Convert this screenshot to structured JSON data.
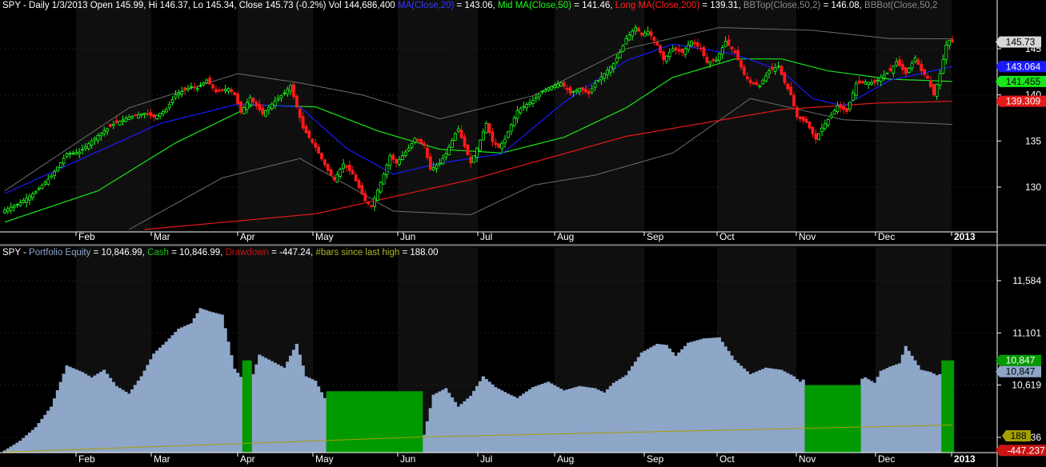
{
  "top_legend": [
    {
      "text": "SPY - Daily 1/3/2013 Open 145.99, Hi 146.37, Lo 145.34, Close 145.73 (-0.2%) Vol 144,686,400 ",
      "color": "#ffffff"
    },
    {
      "text": "MA(Close,20)",
      "color": "#3a3aff"
    },
    {
      "text": " = 143.06, ",
      "color": "#ffffff"
    },
    {
      "text": "Mid MA(Close,50)",
      "color": "#19ff19"
    },
    {
      "text": " = 141.46, ",
      "color": "#ffffff"
    },
    {
      "text": "Long MA(Close,200)",
      "color": "#ff2020"
    },
    {
      "text": " = 139.31, ",
      "color": "#ffffff"
    },
    {
      "text": "BBTop(Close,50,2)",
      "color": "#8c8c8c"
    },
    {
      "text": " = 146.08, ",
      "color": "#ffffff"
    },
    {
      "text": "BBBot(Close,50,2",
      "color": "#8c8c8c"
    }
  ],
  "bottom_legend": [
    {
      "text": "SPY - ",
      "color": "#ffffff"
    },
    {
      "text": "Portfolio Equity",
      "color": "#8ea6c8"
    },
    {
      "text": " = 10,846.99, ",
      "color": "#ffffff"
    },
    {
      "text": "Cash",
      "color": "#19c819"
    },
    {
      "text": " = 10,846.99, ",
      "color": "#ffffff"
    },
    {
      "text": "Drawdown",
      "color": "#c81414"
    },
    {
      "text": " = -447.24, ",
      "color": "#ffffff"
    },
    {
      "text": "#bars since last high",
      "color": "#b4b428"
    },
    {
      "text": " = 188.00",
      "color": "#ffffff"
    }
  ],
  "chart_data": [
    {
      "type": "candlestick",
      "symbol": "SPY",
      "interval": "Daily",
      "x_labels": [
        "Feb",
        "Mar",
        "Apr",
        "May",
        "Jun",
        "Jul",
        "Aug",
        "Sep",
        "Oct",
        "Nov",
        "Dec",
        "2013"
      ],
      "y_ticks": [
        130,
        135,
        140,
        145
      ],
      "ylim": [
        125.4,
        148.9
      ],
      "colors": {
        "up": "#19ff19",
        "down": "#ff1a1a",
        "ma20": "#1a1aff",
        "ma50": "#19e619",
        "ma200": "#e61919",
        "bb": "#6e6e6e"
      },
      "close_anchors": [
        [
          0,
          127.5
        ],
        [
          5,
          128.3
        ],
        [
          10,
          129.5
        ],
        [
          15,
          131.2
        ],
        [
          20,
          133.6
        ],
        [
          24,
          133.8
        ],
        [
          30,
          135.6
        ],
        [
          35,
          136.8
        ],
        [
          40,
          137.6
        ],
        [
          45,
          138.0
        ],
        [
          48,
          137.6
        ],
        [
          52,
          138.4
        ],
        [
          55,
          140.0
        ],
        [
          60,
          140.9
        ],
        [
          62,
          140.7
        ],
        [
          65,
          141.6
        ],
        [
          68,
          140.3
        ],
        [
          72,
          140.7
        ],
        [
          74,
          140.0
        ],
        [
          76,
          138.1
        ],
        [
          79,
          139.7
        ],
        [
          83,
          137.9
        ],
        [
          86,
          139.0
        ],
        [
          90,
          140.2
        ],
        [
          92,
          141.0
        ],
        [
          93,
          139.8
        ],
        [
          96,
          136.4
        ],
        [
          100,
          134.3
        ],
        [
          104,
          131.8
        ],
        [
          106,
          130.8
        ],
        [
          109,
          132.5
        ],
        [
          112,
          131.4
        ],
        [
          116,
          128.5
        ],
        [
          118,
          127.9
        ],
        [
          122,
          131.4
        ],
        [
          124,
          133.4
        ],
        [
          126,
          132.6
        ],
        [
          130,
          134.2
        ],
        [
          132,
          135.3
        ],
        [
          135,
          134.5
        ],
        [
          137,
          131.9
        ],
        [
          140,
          132.6
        ],
        [
          142,
          133.6
        ],
        [
          145,
          135.8
        ],
        [
          146,
          136.3
        ],
        [
          148,
          134.4
        ],
        [
          150,
          132.6
        ],
        [
          152,
          134.2
        ],
        [
          155,
          136.9
        ],
        [
          157,
          134.9
        ],
        [
          159,
          134.3
        ],
        [
          161,
          135.2
        ],
        [
          165,
          138.3
        ],
        [
          170,
          139.4
        ],
        [
          173,
          140.4
        ],
        [
          176,
          140.9
        ],
        [
          179,
          141.3
        ],
        [
          182,
          140.2
        ],
        [
          185,
          140.7
        ],
        [
          188,
          140.1
        ],
        [
          190,
          141.2
        ],
        [
          193,
          142.3
        ],
        [
          196,
          143.4
        ],
        [
          198,
          144.6
        ],
        [
          200,
          146.1
        ],
        [
          203,
          147.3
        ],
        [
          205,
          146.5
        ],
        [
          207,
          146.9
        ],
        [
          210,
          145.4
        ],
        [
          212,
          143.8
        ],
        [
          215,
          145.0
        ],
        [
          218,
          144.6
        ],
        [
          221,
          145.8
        ],
        [
          224,
          145.0
        ],
        [
          226,
          143.5
        ],
        [
          229,
          143.8
        ],
        [
          232,
          145.8
        ],
        [
          235,
          144.6
        ],
        [
          238,
          142.2
        ],
        [
          240,
          141.3
        ],
        [
          243,
          141.0
        ],
        [
          246,
          142.6
        ],
        [
          249,
          143.1
        ],
        [
          251,
          141.3
        ],
        [
          253,
          140.0
        ],
        [
          255,
          137.6
        ],
        [
          258,
          137.0
        ],
        [
          261,
          135.2
        ],
        [
          263,
          136.4
        ],
        [
          266,
          137.8
        ],
        [
          268,
          138.8
        ],
        [
          271,
          138.2
        ],
        [
          274,
          141.2
        ],
        [
          277,
          141.4
        ],
        [
          280,
          141.3
        ],
        [
          282,
          141.9
        ],
        [
          285,
          142.6
        ],
        [
          287,
          143.6
        ],
        [
          290,
          142.3
        ],
        [
          293,
          144.0
        ],
        [
          295,
          142.6
        ],
        [
          297,
          141.8
        ],
        [
          299,
          140.0
        ],
        [
          301,
          142.3
        ],
        [
          303,
          145.4
        ],
        [
          304,
          145.9
        ],
        [
          305,
          145.73
        ]
      ],
      "ma20": [
        [
          0,
          129.3
        ],
        [
          50,
          136.9
        ],
        [
          75,
          139.0
        ],
        [
          95,
          138.7
        ],
        [
          110,
          134.2
        ],
        [
          125,
          131.4
        ],
        [
          140,
          132.6
        ],
        [
          160,
          133.6
        ],
        [
          180,
          139.2
        ],
        [
          200,
          143.7
        ],
        [
          215,
          145.5
        ],
        [
          235,
          144.4
        ],
        [
          250,
          142.6
        ],
        [
          260,
          139.6
        ],
        [
          270,
          138.8
        ],
        [
          285,
          141.6
        ],
        [
          305,
          143.06
        ]
      ],
      "ma50": [
        [
          0,
          126.2
        ],
        [
          30,
          129.6
        ],
        [
          55,
          134.8
        ],
        [
          80,
          138.9
        ],
        [
          100,
          138.7
        ],
        [
          120,
          136.1
        ],
        [
          140,
          134.1
        ],
        [
          160,
          133.7
        ],
        [
          180,
          135.4
        ],
        [
          200,
          138.6
        ],
        [
          215,
          141.9
        ],
        [
          235,
          143.9
        ],
        [
          250,
          143.9
        ],
        [
          265,
          142.6
        ],
        [
          285,
          141.7
        ],
        [
          305,
          141.46
        ]
      ],
      "ma200": [
        [
          45,
          125.4
        ],
        [
          100,
          127.1
        ],
        [
          150,
          130.8
        ],
        [
          200,
          135.5
        ],
        [
          250,
          138.4
        ],
        [
          280,
          139.1
        ],
        [
          305,
          139.31
        ]
      ],
      "bb_top": [
        [
          0,
          129.6
        ],
        [
          40,
          138.6
        ],
        [
          75,
          142.3
        ],
        [
          95,
          141.3
        ],
        [
          115,
          140.0
        ],
        [
          140,
          137.4
        ],
        [
          170,
          139.9
        ],
        [
          200,
          145.0
        ],
        [
          230,
          147.3
        ],
        [
          260,
          147.0
        ],
        [
          285,
          146.1
        ],
        [
          305,
          146.08
        ]
      ],
      "bb_bottom": [
        [
          40,
          125.4
        ],
        [
          70,
          131.0
        ],
        [
          95,
          133.1
        ],
        [
          125,
          127.4
        ],
        [
          150,
          127.0
        ],
        [
          170,
          130.2
        ],
        [
          190,
          131.3
        ],
        [
          215,
          133.7
        ],
        [
          240,
          139.6
        ],
        [
          270,
          137.3
        ],
        [
          305,
          136.8
        ]
      ],
      "price_markers": [
        {
          "label": "145.73",
          "value": 145.73,
          "bg": "#d7d7d7",
          "fg": "#000000"
        },
        {
          "label": "143.064",
          "value": 143.064,
          "bg": "#1a1aff",
          "fg": "#ffffff"
        },
        {
          "label": "141.455",
          "value": 141.455,
          "bg": "#19e619",
          "fg": "#000000"
        },
        {
          "label": "139.309",
          "value": 139.309,
          "bg": "#e61919",
          "fg": "#ffffff"
        }
      ]
    },
    {
      "type": "area",
      "symbol": "SPY",
      "x_labels": [
        "Feb",
        "Mar",
        "Apr",
        "May",
        "Jun",
        "Jul",
        "Aug",
        "Sep",
        "Oct",
        "Nov",
        "Dec",
        "2013"
      ],
      "y_ticks": [
        10136,
        10619,
        11101,
        11584
      ],
      "ylim": [
        9995,
        11798
      ],
      "colors": {
        "equity": "#8ea6c8",
        "cash": "#009a00",
        "bars": "#a4a000",
        "drawdown": "#c81414"
      },
      "equity_anchors": [
        [
          0,
          10015
        ],
        [
          5,
          10105
        ],
        [
          10,
          10230
        ],
        [
          15,
          10420
        ],
        [
          20,
          10800
        ],
        [
          25,
          10740
        ],
        [
          28,
          10690
        ],
        [
          32,
          10760
        ],
        [
          36,
          10610
        ],
        [
          40,
          10540
        ],
        [
          44,
          10700
        ],
        [
          48,
          10910
        ],
        [
          52,
          11020
        ],
        [
          56,
          11140
        ],
        [
          60,
          11190
        ],
        [
          63,
          11330
        ],
        [
          66,
          11300
        ],
        [
          70,
          11270
        ],
        [
          74,
          10770
        ],
        [
          78,
          10620
        ],
        [
          80,
          10720
        ],
        [
          82,
          10900
        ],
        [
          86,
          10840
        ],
        [
          90,
          10780
        ],
        [
          94,
          11000
        ],
        [
          97,
          10700
        ],
        [
          100,
          10660
        ],
        [
          103,
          10500
        ],
        [
          106,
          10560
        ],
        [
          135,
          10160
        ],
        [
          138,
          10530
        ],
        [
          142,
          10590
        ],
        [
          146,
          10420
        ],
        [
          150,
          10520
        ],
        [
          154,
          10700
        ],
        [
          158,
          10600
        ],
        [
          162,
          10540
        ],
        [
          165,
          10500
        ],
        [
          170,
          10600
        ],
        [
          175,
          10650
        ],
        [
          180,
          10570
        ],
        [
          185,
          10610
        ],
        [
          190,
          10590
        ],
        [
          193,
          10550
        ],
        [
          196,
          10640
        ],
        [
          200,
          10710
        ],
        [
          205,
          10920
        ],
        [
          210,
          11000
        ],
        [
          213,
          10990
        ],
        [
          216,
          10890
        ],
        [
          220,
          11010
        ],
        [
          225,
          11050
        ],
        [
          230,
          11060
        ],
        [
          235,
          10850
        ],
        [
          240,
          10720
        ],
        [
          245,
          10780
        ],
        [
          250,
          10760
        ],
        [
          254,
          10700
        ],
        [
          256,
          10650
        ],
        [
          258,
          10690
        ],
        [
          273,
          10640
        ],
        [
          277,
          10690
        ],
        [
          280,
          10640
        ],
        [
          282,
          10750
        ],
        [
          285,
          10790
        ],
        [
          288,
          10820
        ],
        [
          290,
          10980
        ],
        [
          292,
          10890
        ],
        [
          295,
          10760
        ],
        [
          298,
          10740
        ],
        [
          300,
          10710
        ],
        [
          302,
          10730
        ],
        [
          303,
          10847
        ],
        [
          305,
          10847
        ]
      ],
      "cash_blocks": [
        {
          "x_from": 77,
          "x_to": 80,
          "value": 10847
        },
        {
          "x_from": 104,
          "x_to": 135,
          "value": 10562
        },
        {
          "x_from": 258,
          "x_to": 276,
          "value": 10619
        },
        {
          "x_from": 302,
          "x_to": 306,
          "value": 10847
        }
      ],
      "bars_since_high_line": [
        [
          0,
          10000
        ],
        [
          135,
          10140
        ],
        [
          305,
          10250
        ]
      ],
      "value_markers": [
        {
          "label": "10,847",
          "value": 10847,
          "bg": "#009a00",
          "fg": "#ffffff"
        },
        {
          "label": "10,847",
          "value": 10847,
          "bg": "#8ea6c8",
          "fg": "#000000",
          "offset": 14
        },
        {
          "label": "188",
          "value": 10150,
          "bg": "#a4a000",
          "fg": "#000000",
          "dx": 8
        },
        {
          "label": "-447.237",
          "value": 10015,
          "bg": "#c81414",
          "fg": "#ffffff"
        }
      ]
    }
  ]
}
